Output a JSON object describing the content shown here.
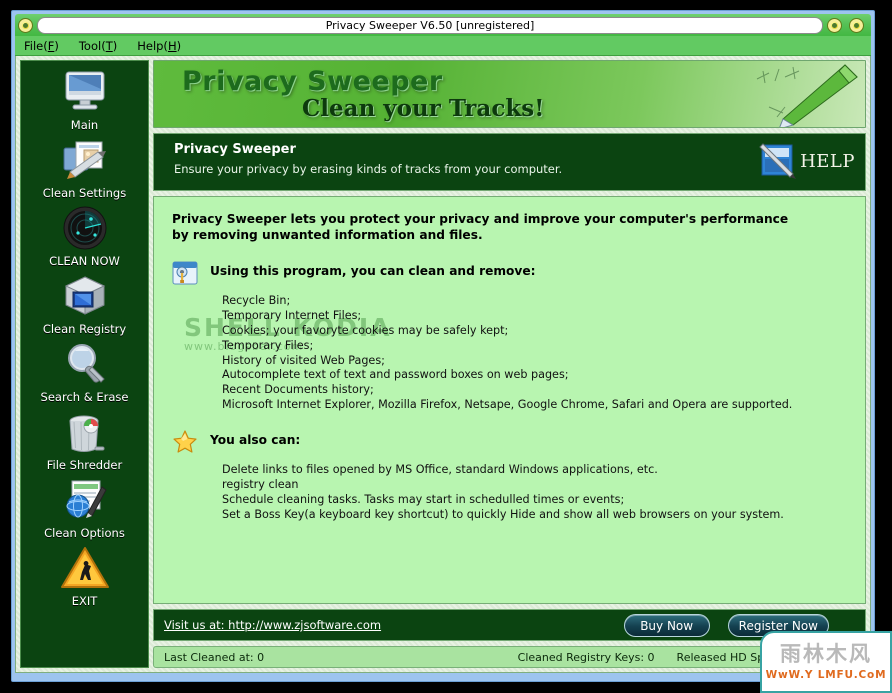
{
  "window": {
    "title": "Privacy Sweeper V6.50 [unregistered]",
    "title_orb_icon": "app-orb-icon",
    "minimize_icon": "minimize-orb-icon",
    "close_icon": "close-orb-icon"
  },
  "menubar": {
    "items": [
      {
        "label": "File(F)",
        "accel": "F",
        "name": "menu-file"
      },
      {
        "label": "Tool(T)",
        "accel": "T",
        "name": "menu-tool"
      },
      {
        "label": "Help(H)",
        "accel": "H",
        "name": "menu-help"
      }
    ]
  },
  "sidebar": {
    "items": [
      {
        "label": "Main",
        "icon": "monitor-icon"
      },
      {
        "label": "Clean Settings",
        "icon": "documents-pencil-icon"
      },
      {
        "label": "CLEAN NOW",
        "icon": "radar-icon"
      },
      {
        "label": "Clean Registry",
        "icon": "registry-cube-icon"
      },
      {
        "label": "Search & Erase",
        "icon": "magnifier-icon"
      },
      {
        "label": "File Shredder",
        "icon": "trash-can-icon"
      },
      {
        "label": "Clean Options",
        "icon": "globe-pencil-icon"
      },
      {
        "label": "EXIT",
        "icon": "exit-warning-triangle-icon"
      }
    ]
  },
  "banner": {
    "title": "Privacy Sweeper",
    "subtitle": "Clean your Tracks!",
    "art_icon": "pencil-icon"
  },
  "headpanel": {
    "title": "Privacy Sweeper",
    "subtitle": "Ensure your privacy by erasing kinds of tracks from your computer.",
    "help_label": "HELP",
    "help_icon": "help-book-pen-icon"
  },
  "content": {
    "intro_line1": "Privacy Sweeper lets you protect your privacy and improve your computer's performance",
    "intro_line2": "by removing unwanted information and files.",
    "watermark_line1": "SHELL KODIA",
    "watermark_line2": "www.blogsbar.com",
    "section1": {
      "icon": "clean-window-broom-icon",
      "title": "Using this program, you can clean and remove:",
      "items": [
        "Recycle Bin;",
        "Temporary Internet Files;",
        "Cookies; your favoryte cookies may be safely kept;",
        "Temporary Files;",
        "History of visited Web Pages;",
        "Autocomplete text of text and password boxes on web pages;",
        "Recent Documents history;",
        "Microsoft Internet Explorer, Mozilla Firefox, Netsape, Google Chrome, Safari and Opera are supported."
      ]
    },
    "section2": {
      "icon": "star-icon",
      "title": "You also can:",
      "items": [
        "Delete links to files opened by MS Office, standard Windows applications, etc.",
        "registry clean",
        "Schedule cleaning tasks. Tasks may start in schedulled times or events;",
        "Set a Boss Key(a keyboard key shortcut) to quickly Hide and show all web browsers on your system."
      ]
    }
  },
  "footer": {
    "site_link": "Visit us at: http://www.zjsoftware.com",
    "buy_button": "Buy Now",
    "register_button": "Register Now"
  },
  "statusbar": {
    "last_cleaned": "Last Cleaned at:  0",
    "cleaned_registry_keys": "Cleaned Registry Keys: 0",
    "released_hd_space": "Released HD Space:0.00MB"
  },
  "site_watermark": {
    "chinese": "雨林木风",
    "url": "WwW.Y LMFU.CoM"
  },
  "colors": {
    "titlebar_green": "#56c156",
    "menubar_green": "#62ca62",
    "dark_green": "#0b4411",
    "content_green": "#b8f5b0",
    "status_green": "#a9e3a0",
    "desktop_blue": "#9dc4ef",
    "accent_orange": "#e06a1e"
  }
}
